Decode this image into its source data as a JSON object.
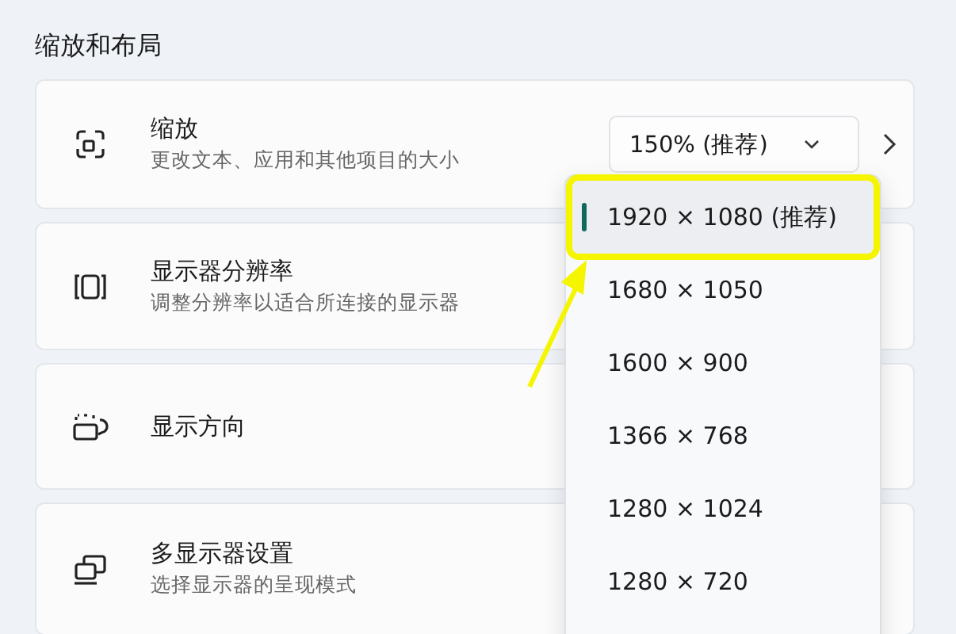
{
  "section_title": "缩放和布局",
  "cards": [
    {
      "kind": "scale",
      "title": "缩放",
      "subtitle": "更改文本、应用和其他项目的大小",
      "dropdown": {
        "value": "150% (推荐)"
      }
    },
    {
      "kind": "resolution",
      "title": "显示器分辨率",
      "subtitle": "调整分辨率以适合所连接的显示器"
    },
    {
      "kind": "orientation",
      "title": "显示方向"
    },
    {
      "kind": "multi",
      "title": "多显示器设置",
      "subtitle": "选择显示器的呈现模式"
    }
  ],
  "resolution_menu": [
    {
      "label": "1920 × 1080 (推荐)",
      "selected": true,
      "highlighted": true
    },
    {
      "label": "1680 × 1050",
      "selected": false,
      "highlighted": false
    },
    {
      "label": "1600 × 900",
      "selected": false,
      "highlighted": false
    },
    {
      "label": "1366 × 768",
      "selected": false,
      "highlighted": false
    },
    {
      "label": "1280 × 1024",
      "selected": false,
      "highlighted": false
    },
    {
      "label": "1280 × 720",
      "selected": false,
      "highlighted": false
    }
  ]
}
